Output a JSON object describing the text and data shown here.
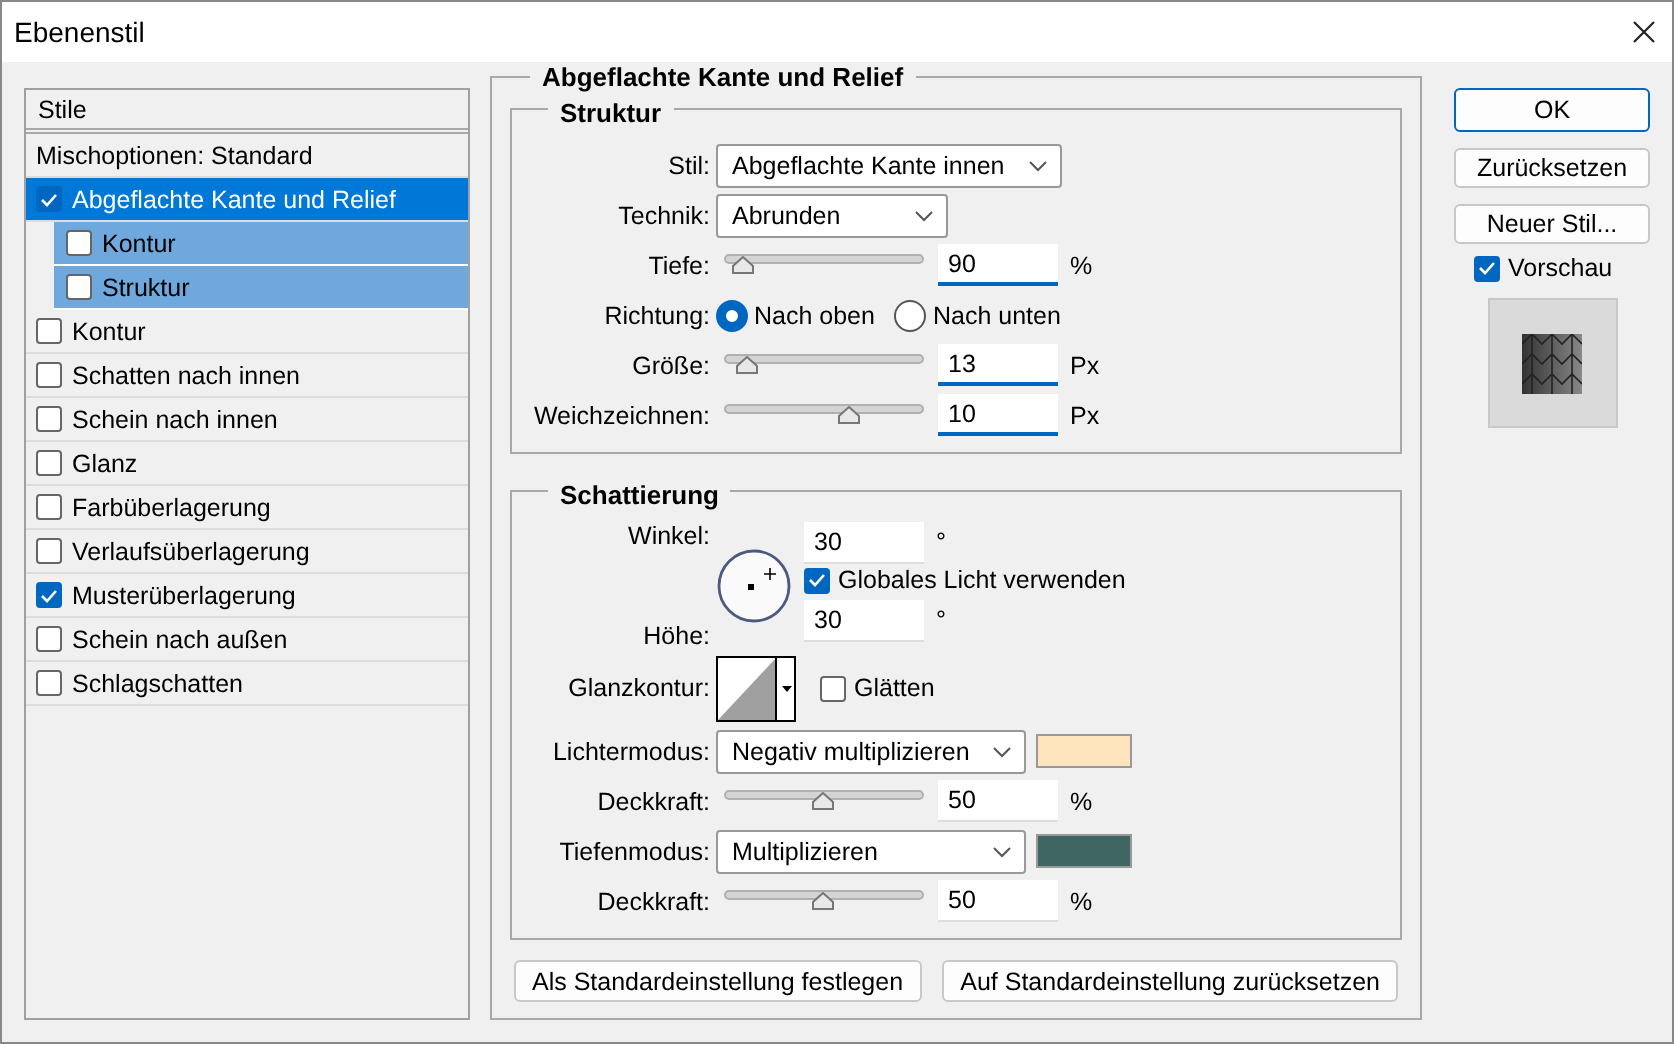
{
  "window": {
    "title": "Ebenenstil"
  },
  "styles_list": {
    "header": "Stile",
    "blending": "Mischoptionen: Standard",
    "items": [
      {
        "label": "Abgeflachte Kante und Relief",
        "checked": true,
        "selected": true,
        "children": [
          {
            "label": "Kontur",
            "checked": false
          },
          {
            "label": "Struktur",
            "checked": false
          }
        ]
      },
      {
        "label": "Kontur",
        "checked": false,
        "selected": false
      },
      {
        "label": "Schatten nach innen",
        "checked": false,
        "selected": false
      },
      {
        "label": "Schein nach innen",
        "checked": false,
        "selected": false
      },
      {
        "label": "Glanz",
        "checked": false,
        "selected": false
      },
      {
        "label": "Farbüberlagerung",
        "checked": false,
        "selected": false
      },
      {
        "label": "Verlaufsüberlagerung",
        "checked": false,
        "selected": false
      },
      {
        "label": "Musterüberlagerung",
        "checked": true,
        "selected": false
      },
      {
        "label": "Schein nach außen",
        "checked": false,
        "selected": false
      },
      {
        "label": "Schlagschatten",
        "checked": false,
        "selected": false
      }
    ]
  },
  "panel": {
    "title": "Abgeflachte Kante und Relief",
    "structure": {
      "title": "Struktur",
      "rows": [
        {
          "kind": "select",
          "label": "Stil:",
          "value": "Abgeflachte Kante innen",
          "wide": true
        },
        {
          "kind": "select",
          "label": "Technik:",
          "value": "Abrunden",
          "wide": false
        },
        {
          "kind": "slider",
          "label": "Tiefe:",
          "level": 0.09,
          "value": "90",
          "unit": "%"
        },
        {
          "kind": "radio",
          "label": "Richtung:",
          "options": [
            {
              "label": "Nach oben",
              "selected": true
            },
            {
              "label": "Nach unten",
              "selected": false
            }
          ]
        },
        {
          "kind": "slider",
          "label": "Größe:",
          "level": 0.11,
          "value": "13",
          "unit": "Px"
        },
        {
          "kind": "slider",
          "label": "Weichzeichnen:",
          "level": 0.62,
          "value": "10",
          "unit": "Px"
        }
      ]
    },
    "shading": {
      "title": "Schattierung",
      "angle": {
        "label": "Winkel:",
        "value": "30",
        "unit": "°"
      },
      "global_light": {
        "label": "Globales Licht verwenden",
        "checked": true
      },
      "altitude": {
        "label": "Höhe:",
        "value": "30",
        "unit": "°"
      },
      "gloss_contour": {
        "label": "Glanzkontur:"
      },
      "anti_aliased": {
        "label": "Glätten",
        "checked": false
      },
      "rows": [
        {
          "kind": "select",
          "label": "Lichtermodus:",
          "value": "Negativ multiplizieren",
          "color": "#ffe5bd"
        },
        {
          "kind": "slider",
          "label": "Deckkraft:",
          "level": 0.49,
          "value": "50",
          "unit": "%"
        },
        {
          "kind": "select",
          "label": "Tiefenmodus:",
          "value": "Multiplizieren",
          "color": "#3f6662"
        },
        {
          "kind": "slider",
          "label": "Deckkraft:",
          "level": 0.49,
          "value": "50",
          "unit": "%"
        }
      ]
    },
    "buttons": [
      "Als Standardeinstellung festlegen",
      "Auf Standardeinstellung zurücksetzen"
    ]
  },
  "actions": [
    {
      "label": "OK",
      "default": true
    },
    {
      "label": "Zurücksetzen",
      "default": false
    },
    {
      "label": "Neuer Stil...",
      "default": false
    }
  ],
  "preview": {
    "label": "Vorschau",
    "checked": true
  }
}
